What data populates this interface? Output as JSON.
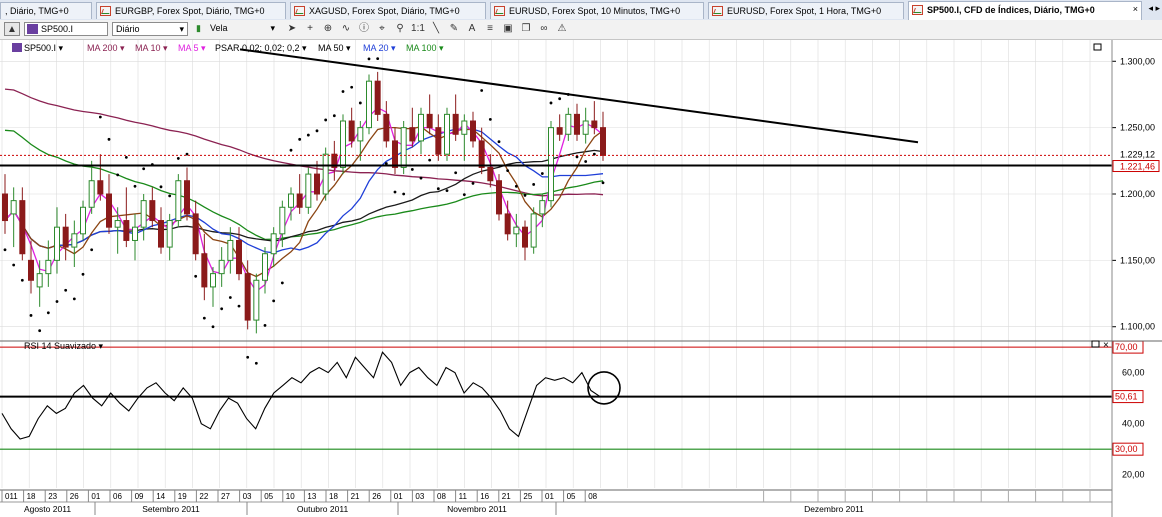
{
  "tabs": [
    {
      "label": ", Diário, TMG+0",
      "active": false
    },
    {
      "label": "EURGBP, Forex Spot, Diário, TMG+0",
      "active": false
    },
    {
      "label": "XAGUSD, Forex Spot, Diário, TMG+0",
      "active": false
    },
    {
      "label": "EURUSD, Forex Spot, 10 Minutos, TMG+0",
      "active": false
    },
    {
      "label": "EURUSD, Forex Spot, 1 Hora, TMG+0",
      "active": false
    },
    {
      "label": "SP500.I, CFD de Índices, Diário, TMG+0",
      "active": true,
      "close": "×"
    }
  ],
  "tab_nav": "◂ ▸",
  "toolbar": {
    "symbol": "SP500.I",
    "period": "Diário",
    "chart_type": "Vela",
    "tools": [
      "cursor-icon",
      "crosshair-icon",
      "zoom-icon",
      "indicator-icon",
      "info-icon",
      "cursor-list-icon",
      "zoom-in-icon",
      "one-to-one-icon",
      "line-icon",
      "pen-icon",
      "text-icon",
      "fib-icon",
      "save-icon",
      "copy-icon",
      "link-icon",
      "alert-icon"
    ]
  },
  "legend": {
    "symbol": "SP500.I ▾",
    "items": [
      {
        "label": "MA 200 ▾",
        "color": "#8b2252"
      },
      {
        "label": "MA 10 ▾",
        "color": "#8b2252"
      },
      {
        "label": "MA 5 ▾",
        "color": "#e020e0"
      },
      {
        "label": "PSAR 0,02; 0,02; 0,2 ▾",
        "color": "#000000"
      },
      {
        "label": "MA 50 ▾",
        "color": "#000000"
      },
      {
        "label": "MA 20 ▾",
        "color": "#1f3fd8"
      },
      {
        "label": "MA 100 ▾",
        "color": "#1a8a1a"
      }
    ]
  },
  "price_axis": {
    "ticks": [
      "1.300,00",
      "1.250,00",
      "1.200,00",
      "1.150,00",
      "1.100,00"
    ],
    "last_price": "1.229,12",
    "support_level": "1.221,46"
  },
  "rsi": {
    "title": "RSI 14 Suavizado ▾",
    "ticks": [
      "60,00",
      "40,00",
      "20,00"
    ],
    "upper": "70,00",
    "lower": "30,00",
    "current": "50,61"
  },
  "time_axis": {
    "days": [
      "011",
      "18",
      "23",
      "26",
      "01",
      "06",
      "09",
      "14",
      "19",
      "22",
      "27",
      "03",
      "05",
      "10",
      "13",
      "18",
      "21",
      "26",
      "01",
      "03",
      "08",
      "11",
      "16",
      "21",
      "25",
      "01",
      "05",
      "08"
    ],
    "months": [
      "Agosto 2011",
      "Setembro 2011",
      "Outubro 2011",
      "Novembro 2011",
      "Dezembro 2011"
    ]
  },
  "chart_data": {
    "type": "candlestick",
    "y_range": [
      1090,
      1310
    ],
    "price_ticks": [
      1300,
      1250,
      1200,
      1150,
      1100
    ],
    "last_price": 1229.12,
    "support": 1221.46,
    "rsi_range": [
      14,
      72
    ],
    "rsi_levels": [
      70,
      50.61,
      30
    ],
    "colors": {
      "up": "#2d8a2d",
      "down": "#8b1a1a",
      "psar": "#000000",
      "ma5": "#e020e0",
      "ma10": "#8b4513",
      "ma20": "#1f3fd8",
      "ma50": "#1a1a1a",
      "ma100": "#1a8a1a",
      "ma200": "#8b2252",
      "last": "#cc0000",
      "rsi": "#000000",
      "rsi_upper": "#cc0000",
      "rsi_lower": "#1a8a1a",
      "grid": "#dcdcdc"
    },
    "candles": [
      {
        "o": 1200,
        "h": 1215,
        "l": 1170,
        "c": 1180
      },
      {
        "o": 1185,
        "h": 1205,
        "l": 1160,
        "c": 1195
      },
      {
        "o": 1195,
        "h": 1205,
        "l": 1150,
        "c": 1155
      },
      {
        "o": 1150,
        "h": 1165,
        "l": 1125,
        "c": 1135
      },
      {
        "o": 1130,
        "h": 1150,
        "l": 1115,
        "c": 1140
      },
      {
        "o": 1140,
        "h": 1165,
        "l": 1130,
        "c": 1150
      },
      {
        "o": 1150,
        "h": 1190,
        "l": 1140,
        "c": 1175
      },
      {
        "o": 1175,
        "h": 1185,
        "l": 1150,
        "c": 1160
      },
      {
        "o": 1160,
        "h": 1180,
        "l": 1145,
        "c": 1170
      },
      {
        "o": 1170,
        "h": 1195,
        "l": 1165,
        "c": 1190
      },
      {
        "o": 1190,
        "h": 1225,
        "l": 1185,
        "c": 1210
      },
      {
        "o": 1210,
        "h": 1230,
        "l": 1195,
        "c": 1200
      },
      {
        "o": 1200,
        "h": 1215,
        "l": 1170,
        "c": 1175
      },
      {
        "o": 1175,
        "h": 1190,
        "l": 1155,
        "c": 1180
      },
      {
        "o": 1180,
        "h": 1205,
        "l": 1160,
        "c": 1165
      },
      {
        "o": 1165,
        "h": 1185,
        "l": 1150,
        "c": 1175
      },
      {
        "o": 1175,
        "h": 1200,
        "l": 1165,
        "c": 1195
      },
      {
        "o": 1195,
        "h": 1205,
        "l": 1175,
        "c": 1180
      },
      {
        "o": 1180,
        "h": 1190,
        "l": 1155,
        "c": 1160
      },
      {
        "o": 1160,
        "h": 1185,
        "l": 1150,
        "c": 1180
      },
      {
        "o": 1180,
        "h": 1215,
        "l": 1175,
        "c": 1210
      },
      {
        "o": 1210,
        "h": 1220,
        "l": 1180,
        "c": 1185
      },
      {
        "o": 1185,
        "h": 1195,
        "l": 1150,
        "c": 1155
      },
      {
        "o": 1155,
        "h": 1170,
        "l": 1120,
        "c": 1130
      },
      {
        "o": 1130,
        "h": 1145,
        "l": 1115,
        "c": 1140
      },
      {
        "o": 1140,
        "h": 1160,
        "l": 1130,
        "c": 1150
      },
      {
        "o": 1150,
        "h": 1175,
        "l": 1140,
        "c": 1165
      },
      {
        "o": 1165,
        "h": 1175,
        "l": 1135,
        "c": 1140
      },
      {
        "o": 1140,
        "h": 1150,
        "l": 1098,
        "c": 1105
      },
      {
        "o": 1105,
        "h": 1140,
        "l": 1095,
        "c": 1135
      },
      {
        "o": 1135,
        "h": 1160,
        "l": 1125,
        "c": 1155
      },
      {
        "o": 1155,
        "h": 1175,
        "l": 1145,
        "c": 1170
      },
      {
        "o": 1170,
        "h": 1195,
        "l": 1160,
        "c": 1190
      },
      {
        "o": 1190,
        "h": 1205,
        "l": 1180,
        "c": 1200
      },
      {
        "o": 1200,
        "h": 1215,
        "l": 1185,
        "c": 1190
      },
      {
        "o": 1190,
        "h": 1220,
        "l": 1185,
        "c": 1215
      },
      {
        "o": 1215,
        "h": 1225,
        "l": 1195,
        "c": 1200
      },
      {
        "o": 1200,
        "h": 1235,
        "l": 1195,
        "c": 1230
      },
      {
        "o": 1230,
        "h": 1240,
        "l": 1210,
        "c": 1220
      },
      {
        "o": 1220,
        "h": 1260,
        "l": 1215,
        "c": 1255
      },
      {
        "o": 1255,
        "h": 1265,
        "l": 1235,
        "c": 1240
      },
      {
        "o": 1240,
        "h": 1255,
        "l": 1225,
        "c": 1250
      },
      {
        "o": 1250,
        "h": 1290,
        "l": 1245,
        "c": 1285
      },
      {
        "o": 1285,
        "h": 1292,
        "l": 1255,
        "c": 1260
      },
      {
        "o": 1260,
        "h": 1270,
        "l": 1235,
        "c": 1240
      },
      {
        "o": 1240,
        "h": 1250,
        "l": 1215,
        "c": 1220
      },
      {
        "o": 1220,
        "h": 1255,
        "l": 1215,
        "c": 1250
      },
      {
        "o": 1250,
        "h": 1265,
        "l": 1235,
        "c": 1240
      },
      {
        "o": 1240,
        "h": 1265,
        "l": 1230,
        "c": 1260
      },
      {
        "o": 1260,
        "h": 1275,
        "l": 1245,
        "c": 1250
      },
      {
        "o": 1250,
        "h": 1260,
        "l": 1225,
        "c": 1230
      },
      {
        "o": 1230,
        "h": 1265,
        "l": 1225,
        "c": 1260
      },
      {
        "o": 1260,
        "h": 1275,
        "l": 1240,
        "c": 1245
      },
      {
        "o": 1245,
        "h": 1260,
        "l": 1225,
        "c": 1255
      },
      {
        "o": 1255,
        "h": 1262,
        "l": 1235,
        "c": 1240
      },
      {
        "o": 1240,
        "h": 1250,
        "l": 1215,
        "c": 1220
      },
      {
        "o": 1220,
        "h": 1230,
        "l": 1205,
        "c": 1210
      },
      {
        "o": 1210,
        "h": 1215,
        "l": 1180,
        "c": 1185
      },
      {
        "o": 1185,
        "h": 1195,
        "l": 1165,
        "c": 1170
      },
      {
        "o": 1170,
        "h": 1185,
        "l": 1160,
        "c": 1175
      },
      {
        "o": 1175,
        "h": 1180,
        "l": 1150,
        "c": 1160
      },
      {
        "o": 1160,
        "h": 1190,
        "l": 1155,
        "c": 1185
      },
      {
        "o": 1185,
        "h": 1200,
        "l": 1175,
        "c": 1195
      },
      {
        "o": 1195,
        "h": 1255,
        "l": 1190,
        "c": 1250
      },
      {
        "o": 1250,
        "h": 1260,
        "l": 1240,
        "c": 1245
      },
      {
        "o": 1245,
        "h": 1265,
        "l": 1240,
        "c": 1260
      },
      {
        "o": 1260,
        "h": 1268,
        "l": 1240,
        "c": 1245
      },
      {
        "o": 1245,
        "h": 1265,
        "l": 1238,
        "c": 1255
      },
      {
        "o": 1255,
        "h": 1270,
        "l": 1245,
        "c": 1250
      },
      {
        "o": 1250,
        "h": 1262,
        "l": 1225,
        "c": 1229.12
      }
    ],
    "rsi_values": [
      44,
      38,
      34,
      35,
      42,
      47,
      44,
      46,
      52,
      55,
      50,
      47,
      52,
      48,
      45,
      50,
      54,
      56,
      52,
      49,
      54,
      50,
      40,
      38,
      45,
      50,
      48,
      42,
      38,
      46,
      52,
      55,
      58,
      56,
      60,
      62,
      60,
      64,
      58,
      66,
      62,
      58,
      68,
      64,
      55,
      60,
      62,
      58,
      55,
      62,
      60,
      52,
      56,
      54,
      50,
      45,
      38,
      35,
      45,
      55,
      58,
      57,
      58,
      56,
      60,
      53,
      50.61
    ],
    "trendline_points": [
      [
        1263.5,
        1238.5
      ]
    ],
    "annotations": [
      "circle-around-last-rsi"
    ]
  }
}
